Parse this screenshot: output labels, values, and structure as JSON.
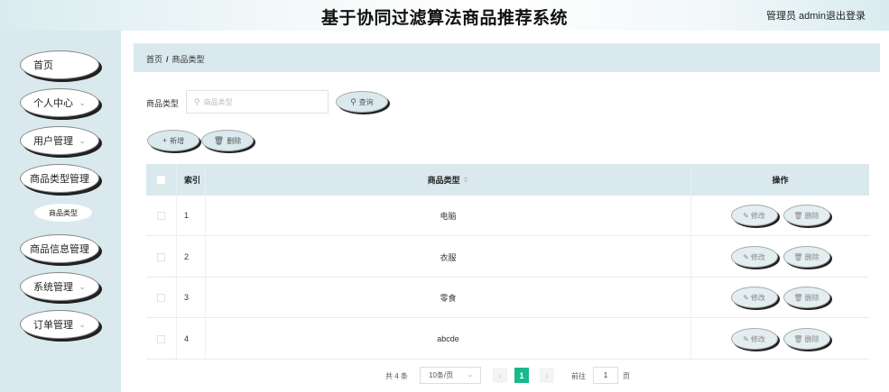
{
  "header": {
    "title": "基于协同过滤算法商品推荐系统",
    "user": "管理员 admin",
    "logout": "退出登录"
  },
  "sidebar": {
    "items": [
      {
        "label": "首页"
      },
      {
        "label": "个人中心"
      },
      {
        "label": "用户管理"
      },
      {
        "label": "商品类型管理"
      },
      {
        "label": "商品信息管理"
      },
      {
        "label": "系统管理"
      },
      {
        "label": "订单管理"
      }
    ],
    "sub_item": "商品类型"
  },
  "breadcrumb": {
    "home": "首页",
    "separator": "/",
    "current": "商品类型"
  },
  "search": {
    "label": "商品类型",
    "placeholder": "商品类型",
    "button": "查询"
  },
  "actions": {
    "add": "新增",
    "delete": "删除"
  },
  "table": {
    "headers": {
      "index": "索引",
      "type": "商品类型",
      "ops": "操作"
    },
    "rows": [
      {
        "index": "1",
        "type": "电脑"
      },
      {
        "index": "2",
        "type": "衣服"
      },
      {
        "index": "3",
        "type": "零食"
      },
      {
        "index": "4",
        "type": "abcde"
      }
    ],
    "edit_label": "修改",
    "delete_label": "删除"
  },
  "pagination": {
    "total": "共 4 条",
    "page_size": "10条/页",
    "current": "1",
    "goto_label": "前往",
    "goto_value": "1",
    "unit": "页"
  },
  "colors": {
    "accent": "#19b88d",
    "panel": "#d9e9ee"
  }
}
